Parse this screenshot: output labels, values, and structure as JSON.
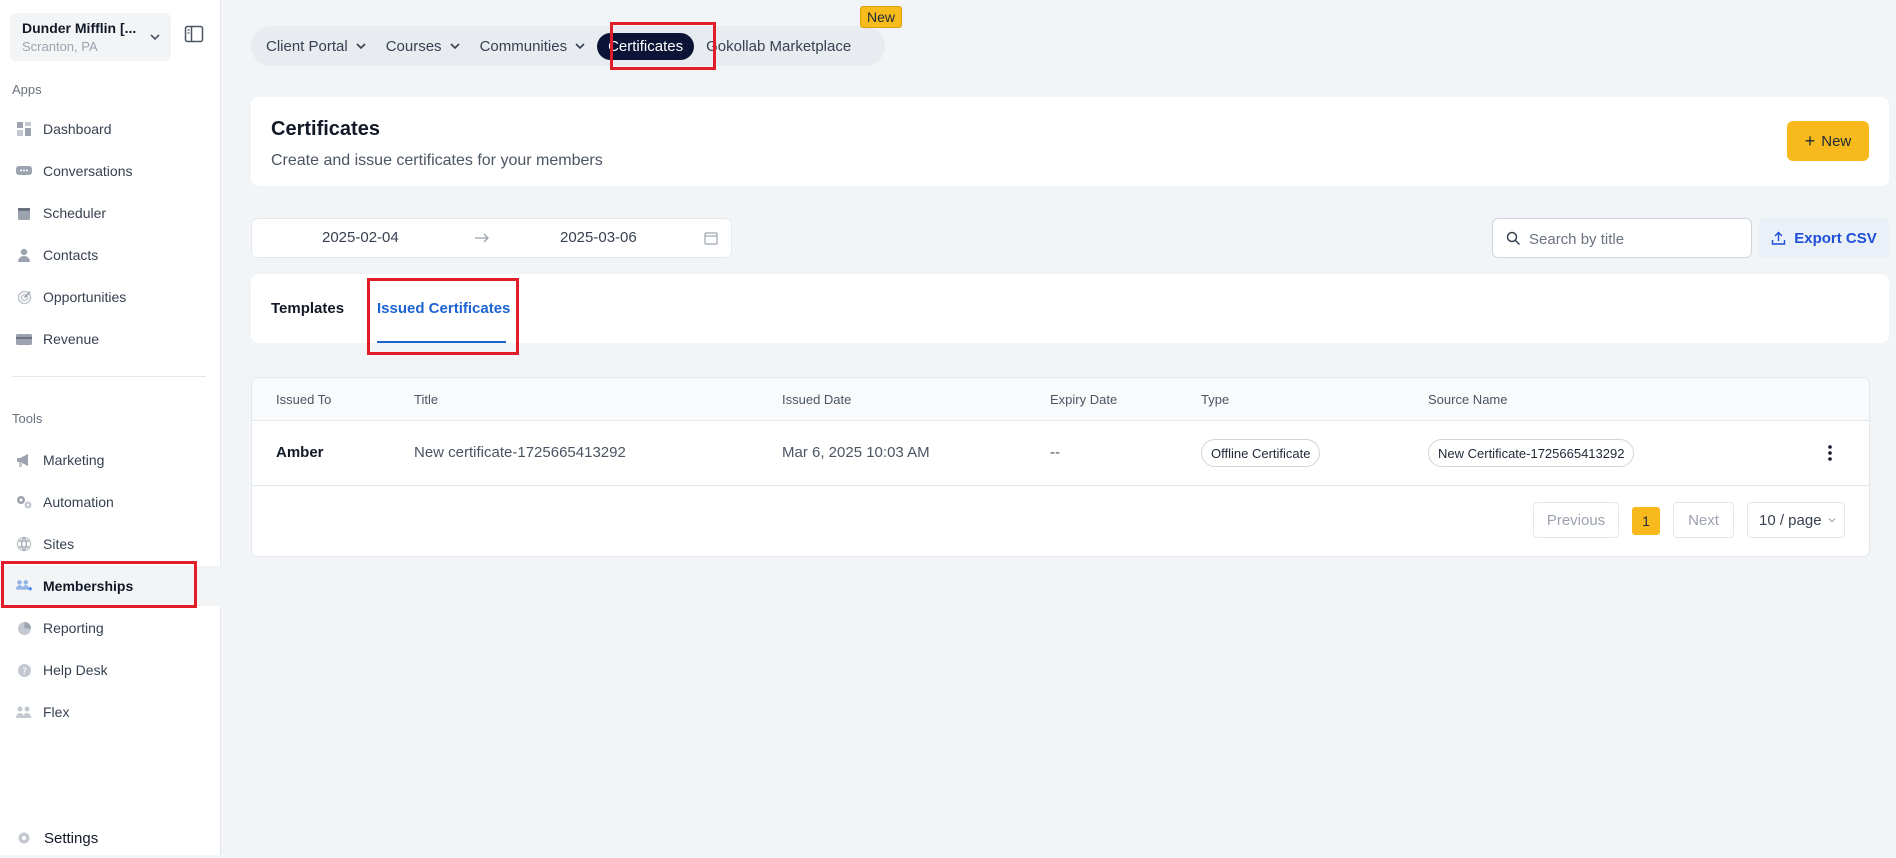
{
  "account": {
    "name": "Dunder Mifflin [...",
    "location": "Scranton, PA"
  },
  "sidebar": {
    "apps_label": "Apps",
    "tools_label": "Tools",
    "apps": [
      {
        "label": "Dashboard",
        "icon": "dashboard-icon"
      },
      {
        "label": "Conversations",
        "icon": "chat-icon"
      },
      {
        "label": "Scheduler",
        "icon": "calendar-icon"
      },
      {
        "label": "Contacts",
        "icon": "user-icon"
      },
      {
        "label": "Opportunities",
        "icon": "target-icon"
      },
      {
        "label": "Revenue",
        "icon": "card-icon"
      }
    ],
    "tools": [
      {
        "label": "Marketing",
        "icon": "megaphone-icon"
      },
      {
        "label": "Automation",
        "icon": "gears-icon"
      },
      {
        "label": "Sites",
        "icon": "globe-icon"
      },
      {
        "label": "Memberships",
        "icon": "members-icon",
        "active": true
      },
      {
        "label": "Reporting",
        "icon": "pie-icon"
      },
      {
        "label": "Help Desk",
        "icon": "help-icon"
      },
      {
        "label": "Flex",
        "icon": "people-icon"
      }
    ],
    "settings_label": "Settings"
  },
  "topnav": {
    "items": [
      "Client Portal",
      "Courses",
      "Communities",
      "Certificates",
      "Gokollab Marketplace"
    ],
    "active": "Certificates",
    "new_badge": "New"
  },
  "header": {
    "title": "Certificates",
    "subtitle": "Create and issue certificates for your members",
    "new_button": "New"
  },
  "filters": {
    "date_start": "2025-02-04",
    "date_end": "2025-03-06",
    "search_placeholder": "Search by title",
    "export_label": "Export CSV"
  },
  "tabs": {
    "templates": "Templates",
    "issued": "Issued Certificates",
    "active": "Issued Certificates"
  },
  "table": {
    "columns": [
      "Issued To",
      "Title",
      "Issued Date",
      "Expiry Date",
      "Type",
      "Source Name"
    ],
    "rows": [
      {
        "issued_to": "Amber",
        "title": "New certificate-1725665413292",
        "issued_date": "Mar 6, 2025 10:03 AM",
        "expiry_date": "--",
        "type": "Offline Certificate",
        "source_name": "New Certificate-1725665413292"
      }
    ]
  },
  "pagination": {
    "previous": "Previous",
    "page": "1",
    "next": "Next",
    "page_size": "10 / page"
  },
  "colors": {
    "accent": "#f7b91c",
    "active_nav": "#0b1437",
    "link_blue": "#1d63d2",
    "highlight": "#e11d2a"
  }
}
